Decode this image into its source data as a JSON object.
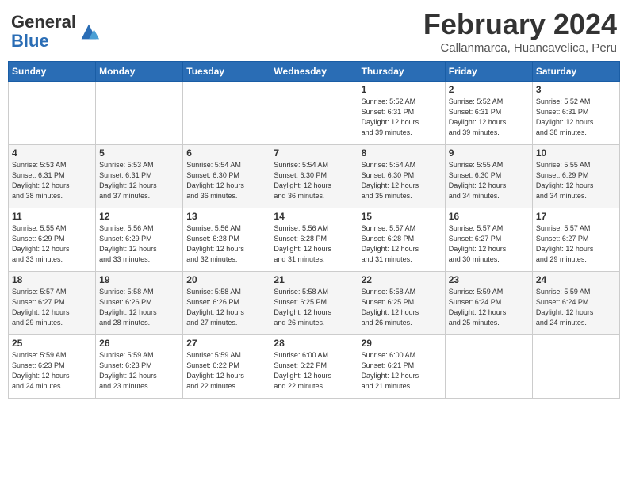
{
  "header": {
    "logo_general": "General",
    "logo_blue": "Blue",
    "month_title": "February 2024",
    "subtitle": "Callanmarca, Huancavelica, Peru"
  },
  "weekdays": [
    "Sunday",
    "Monday",
    "Tuesday",
    "Wednesday",
    "Thursday",
    "Friday",
    "Saturday"
  ],
  "weeks": [
    [
      {
        "day": "",
        "info": ""
      },
      {
        "day": "",
        "info": ""
      },
      {
        "day": "",
        "info": ""
      },
      {
        "day": "",
        "info": ""
      },
      {
        "day": "1",
        "info": "Sunrise: 5:52 AM\nSunset: 6:31 PM\nDaylight: 12 hours\nand 39 minutes."
      },
      {
        "day": "2",
        "info": "Sunrise: 5:52 AM\nSunset: 6:31 PM\nDaylight: 12 hours\nand 39 minutes."
      },
      {
        "day": "3",
        "info": "Sunrise: 5:52 AM\nSunset: 6:31 PM\nDaylight: 12 hours\nand 38 minutes."
      }
    ],
    [
      {
        "day": "4",
        "info": "Sunrise: 5:53 AM\nSunset: 6:31 PM\nDaylight: 12 hours\nand 38 minutes."
      },
      {
        "day": "5",
        "info": "Sunrise: 5:53 AM\nSunset: 6:31 PM\nDaylight: 12 hours\nand 37 minutes."
      },
      {
        "day": "6",
        "info": "Sunrise: 5:54 AM\nSunset: 6:30 PM\nDaylight: 12 hours\nand 36 minutes."
      },
      {
        "day": "7",
        "info": "Sunrise: 5:54 AM\nSunset: 6:30 PM\nDaylight: 12 hours\nand 36 minutes."
      },
      {
        "day": "8",
        "info": "Sunrise: 5:54 AM\nSunset: 6:30 PM\nDaylight: 12 hours\nand 35 minutes."
      },
      {
        "day": "9",
        "info": "Sunrise: 5:55 AM\nSunset: 6:30 PM\nDaylight: 12 hours\nand 34 minutes."
      },
      {
        "day": "10",
        "info": "Sunrise: 5:55 AM\nSunset: 6:29 PM\nDaylight: 12 hours\nand 34 minutes."
      }
    ],
    [
      {
        "day": "11",
        "info": "Sunrise: 5:55 AM\nSunset: 6:29 PM\nDaylight: 12 hours\nand 33 minutes."
      },
      {
        "day": "12",
        "info": "Sunrise: 5:56 AM\nSunset: 6:29 PM\nDaylight: 12 hours\nand 33 minutes."
      },
      {
        "day": "13",
        "info": "Sunrise: 5:56 AM\nSunset: 6:28 PM\nDaylight: 12 hours\nand 32 minutes."
      },
      {
        "day": "14",
        "info": "Sunrise: 5:56 AM\nSunset: 6:28 PM\nDaylight: 12 hours\nand 31 minutes."
      },
      {
        "day": "15",
        "info": "Sunrise: 5:57 AM\nSunset: 6:28 PM\nDaylight: 12 hours\nand 31 minutes."
      },
      {
        "day": "16",
        "info": "Sunrise: 5:57 AM\nSunset: 6:27 PM\nDaylight: 12 hours\nand 30 minutes."
      },
      {
        "day": "17",
        "info": "Sunrise: 5:57 AM\nSunset: 6:27 PM\nDaylight: 12 hours\nand 29 minutes."
      }
    ],
    [
      {
        "day": "18",
        "info": "Sunrise: 5:57 AM\nSunset: 6:27 PM\nDaylight: 12 hours\nand 29 minutes."
      },
      {
        "day": "19",
        "info": "Sunrise: 5:58 AM\nSunset: 6:26 PM\nDaylight: 12 hours\nand 28 minutes."
      },
      {
        "day": "20",
        "info": "Sunrise: 5:58 AM\nSunset: 6:26 PM\nDaylight: 12 hours\nand 27 minutes."
      },
      {
        "day": "21",
        "info": "Sunrise: 5:58 AM\nSunset: 6:25 PM\nDaylight: 12 hours\nand 26 minutes."
      },
      {
        "day": "22",
        "info": "Sunrise: 5:58 AM\nSunset: 6:25 PM\nDaylight: 12 hours\nand 26 minutes."
      },
      {
        "day": "23",
        "info": "Sunrise: 5:59 AM\nSunset: 6:24 PM\nDaylight: 12 hours\nand 25 minutes."
      },
      {
        "day": "24",
        "info": "Sunrise: 5:59 AM\nSunset: 6:24 PM\nDaylight: 12 hours\nand 24 minutes."
      }
    ],
    [
      {
        "day": "25",
        "info": "Sunrise: 5:59 AM\nSunset: 6:23 PM\nDaylight: 12 hours\nand 24 minutes."
      },
      {
        "day": "26",
        "info": "Sunrise: 5:59 AM\nSunset: 6:23 PM\nDaylight: 12 hours\nand 23 minutes."
      },
      {
        "day": "27",
        "info": "Sunrise: 5:59 AM\nSunset: 6:22 PM\nDaylight: 12 hours\nand 22 minutes."
      },
      {
        "day": "28",
        "info": "Sunrise: 6:00 AM\nSunset: 6:22 PM\nDaylight: 12 hours\nand 22 minutes."
      },
      {
        "day": "29",
        "info": "Sunrise: 6:00 AM\nSunset: 6:21 PM\nDaylight: 12 hours\nand 21 minutes."
      },
      {
        "day": "",
        "info": ""
      },
      {
        "day": "",
        "info": ""
      }
    ]
  ]
}
